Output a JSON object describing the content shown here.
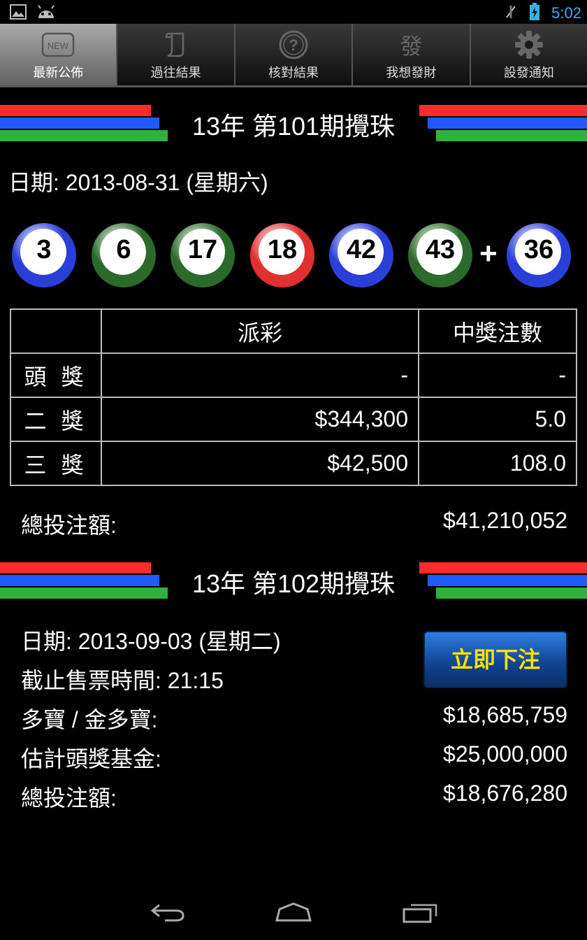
{
  "status_bar": {
    "time": "5:02"
  },
  "tabs": [
    {
      "label": "最新公佈",
      "icon": "new-icon",
      "active": true
    },
    {
      "label": "過往結果",
      "icon": "scroll-icon",
      "active": false
    },
    {
      "label": "核對結果",
      "icon": "question-icon",
      "active": false
    },
    {
      "label": "我想發財",
      "icon": "fa-icon",
      "active": false,
      "glyph": "發"
    },
    {
      "label": "設發通知",
      "icon": "gear-icon",
      "active": false
    }
  ],
  "stripe_colors": {
    "red": "#ff2a2a",
    "blue": "#1f5bff",
    "green": "#2fb13b"
  },
  "draw1": {
    "title": "13年 第101期攪珠",
    "date": "日期: 2013-08-31 (星期六)",
    "balls": [
      {
        "number": "3",
        "color": "blue"
      },
      {
        "number": "6",
        "color": "green"
      },
      {
        "number": "17",
        "color": "green"
      },
      {
        "number": "18",
        "color": "red"
      },
      {
        "number": "42",
        "color": "blue"
      },
      {
        "number": "43",
        "color": "green"
      }
    ],
    "plus": "+",
    "extra_ball": {
      "number": "36",
      "color": "blue"
    },
    "table": {
      "headers": [
        "",
        "派彩",
        "中獎注數"
      ],
      "rows": [
        {
          "prize": "頭 獎",
          "payout": "-",
          "winners": "-"
        },
        {
          "prize": "二 獎",
          "payout": "$344,300",
          "winners": "5.0"
        },
        {
          "prize": "三 獎",
          "payout": "$42,500",
          "winners": "108.0"
        }
      ]
    },
    "turnover_label": "總投注額:",
    "turnover_value": "$41,210,052"
  },
  "draw2": {
    "title": "13年 第102期攪珠",
    "date": "日期: 2013-09-03 (星期二)",
    "closing": "截止售票時間: 21:15",
    "bet_button": "立即下注",
    "snowball_label": "多寶 / 金多寶:",
    "snowball_value": "$18,685,759",
    "jackpot_label": "估計頭獎基金:",
    "jackpot_value": "$25,000,000",
    "turnover_label": "總投注額:",
    "turnover_value": "$18,676,280"
  },
  "ball_colors": {
    "blue": "#2a3fd8",
    "green": "#2c6a2c",
    "red": "#e03030"
  }
}
